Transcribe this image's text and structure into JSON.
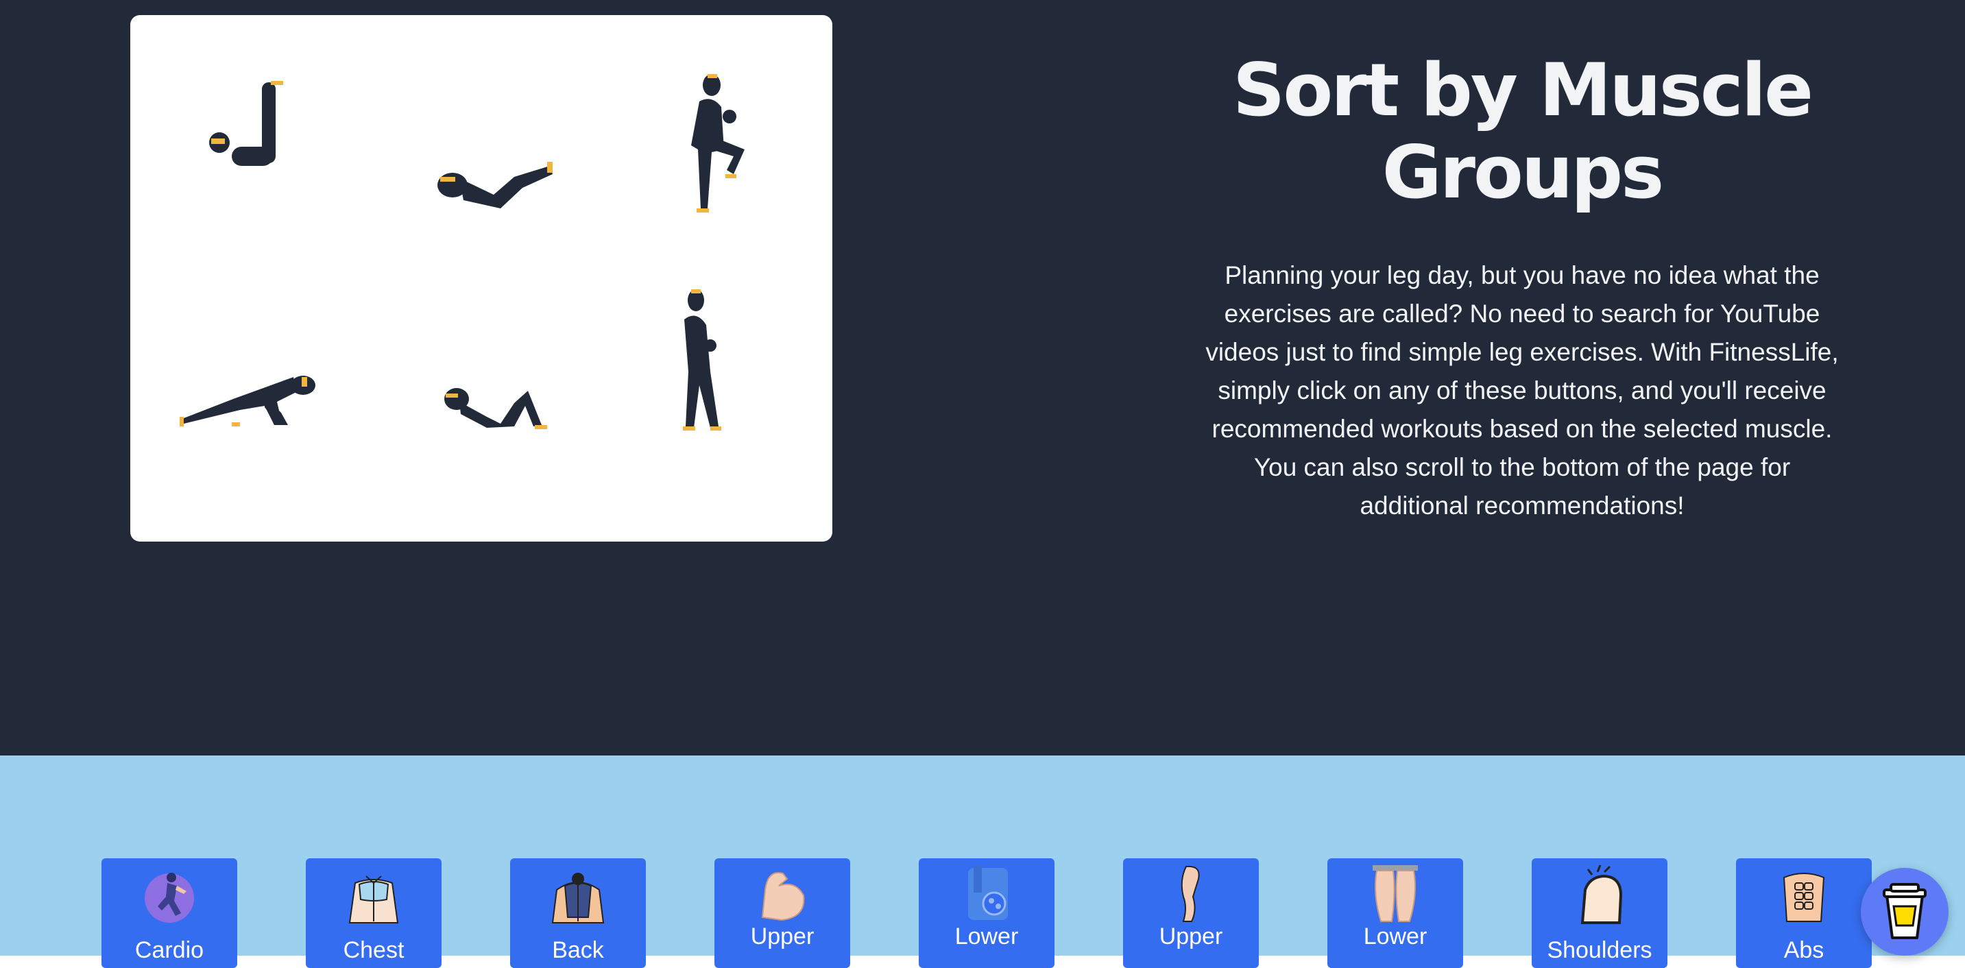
{
  "hero": {
    "title": "Sort by Muscle Groups",
    "description": "Planning your leg day, but you have no idea what the exercises are called? No need to search for YouTube videos just to find simple leg exercises. With FitnessLife, simply click on any of these buttons, and you'll receive recommended workouts based on the selected muscle. You can also scroll to the bottom of the page for additional recommendations!"
  },
  "muscle_buttons": [
    {
      "label": "Cardio",
      "icon": "cardio-icon"
    },
    {
      "label": "Chest",
      "icon": "chest-icon"
    },
    {
      "label": "Back",
      "icon": "back-icon"
    },
    {
      "label": "Upper",
      "icon": "upper-arm-icon"
    },
    {
      "label": "Lower",
      "icon": "lower-arm-icon"
    },
    {
      "label": "Upper",
      "icon": "upper-leg-icon"
    },
    {
      "label": "Lower",
      "icon": "lower-leg-icon"
    },
    {
      "label": "Shoulders",
      "icon": "shoulders-icon"
    },
    {
      "label": "Abs",
      "icon": "abs-icon"
    }
  ],
  "floating_button": {
    "icon": "coffee-cup-icon"
  },
  "colors": {
    "hero_bg": "#222a39",
    "section_bg": "#9bd1ee",
    "button_bg": "#356df0",
    "figure": "#222a39",
    "accent": "#f2b640",
    "floating_bg": "#5e7af7"
  }
}
